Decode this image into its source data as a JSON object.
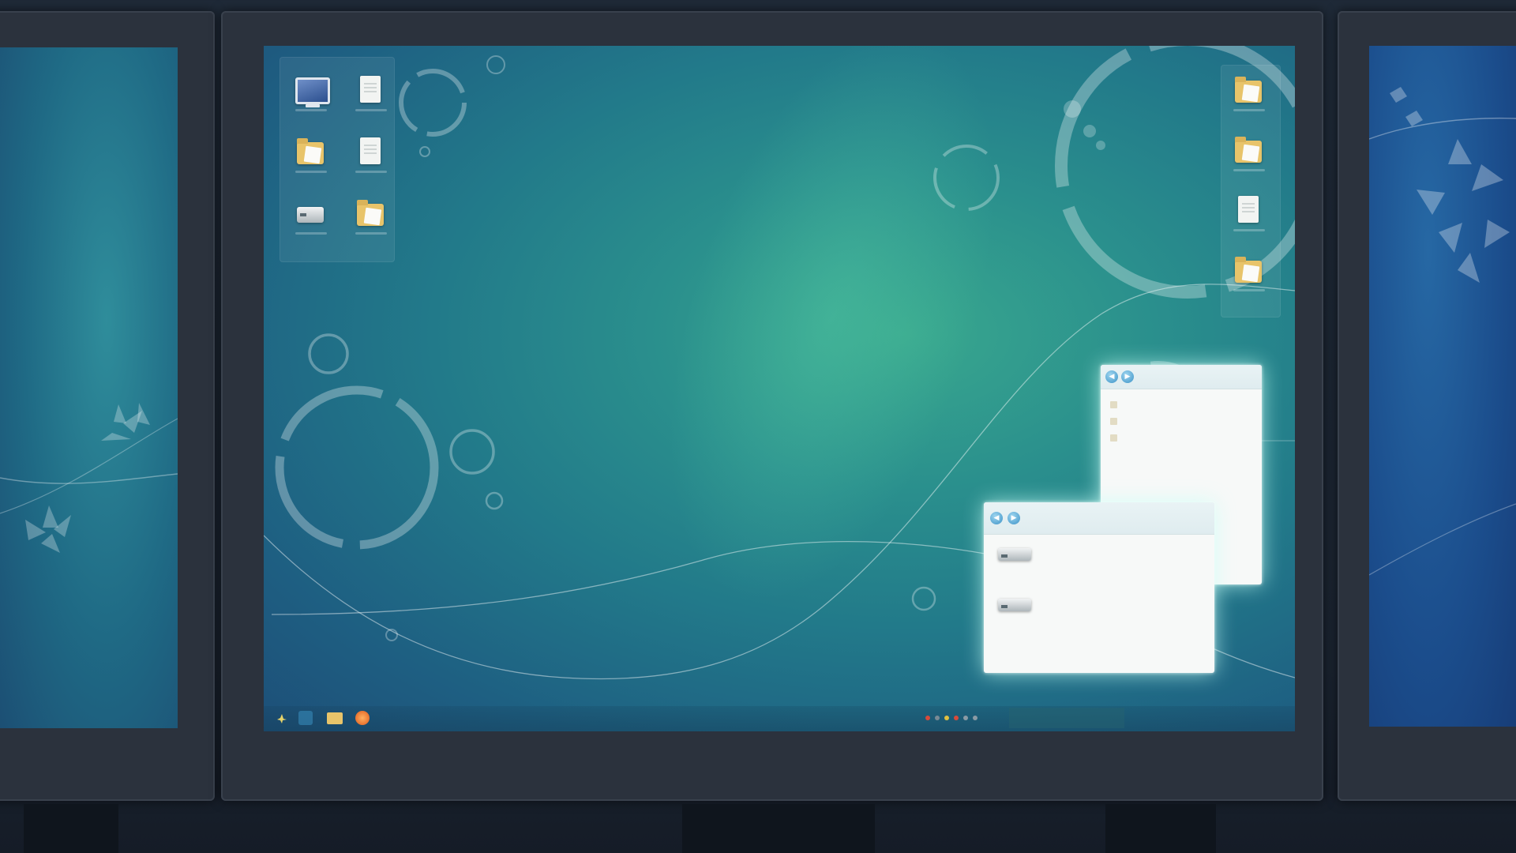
{
  "desktop": {
    "left_icons": [
      {
        "name": "computer-icon",
        "kind": "monitor"
      },
      {
        "name": "document-icon",
        "kind": "file"
      },
      {
        "name": "folder-icon",
        "kind": "folder"
      },
      {
        "name": "document-icon",
        "kind": "file"
      },
      {
        "name": "drive-icon",
        "kind": "drive"
      },
      {
        "name": "folder-icon",
        "kind": "folder"
      }
    ],
    "right_icons": [
      {
        "name": "folder-icon",
        "kind": "folder"
      },
      {
        "name": "folder-icon",
        "kind": "folder"
      },
      {
        "name": "document-icon",
        "kind": "file"
      },
      {
        "name": "folder-icon",
        "kind": "folder"
      }
    ]
  },
  "windows": {
    "explorer_back": {
      "title": "",
      "rows": [
        "",
        "",
        ""
      ]
    },
    "explorer_front": {
      "title": "",
      "items": [
        "",
        ""
      ]
    },
    "side_label": ""
  },
  "taskbar": {
    "icons": [
      "start-icon",
      "browser-icon",
      "folder-icon",
      "media-icon"
    ],
    "clock": ""
  },
  "colors": {
    "desktop_teal": "#2a8f8d",
    "desktop_blue": "#1d4f78",
    "window_glow": "#c8fff5",
    "folder_yellow": "#e8c46a"
  }
}
